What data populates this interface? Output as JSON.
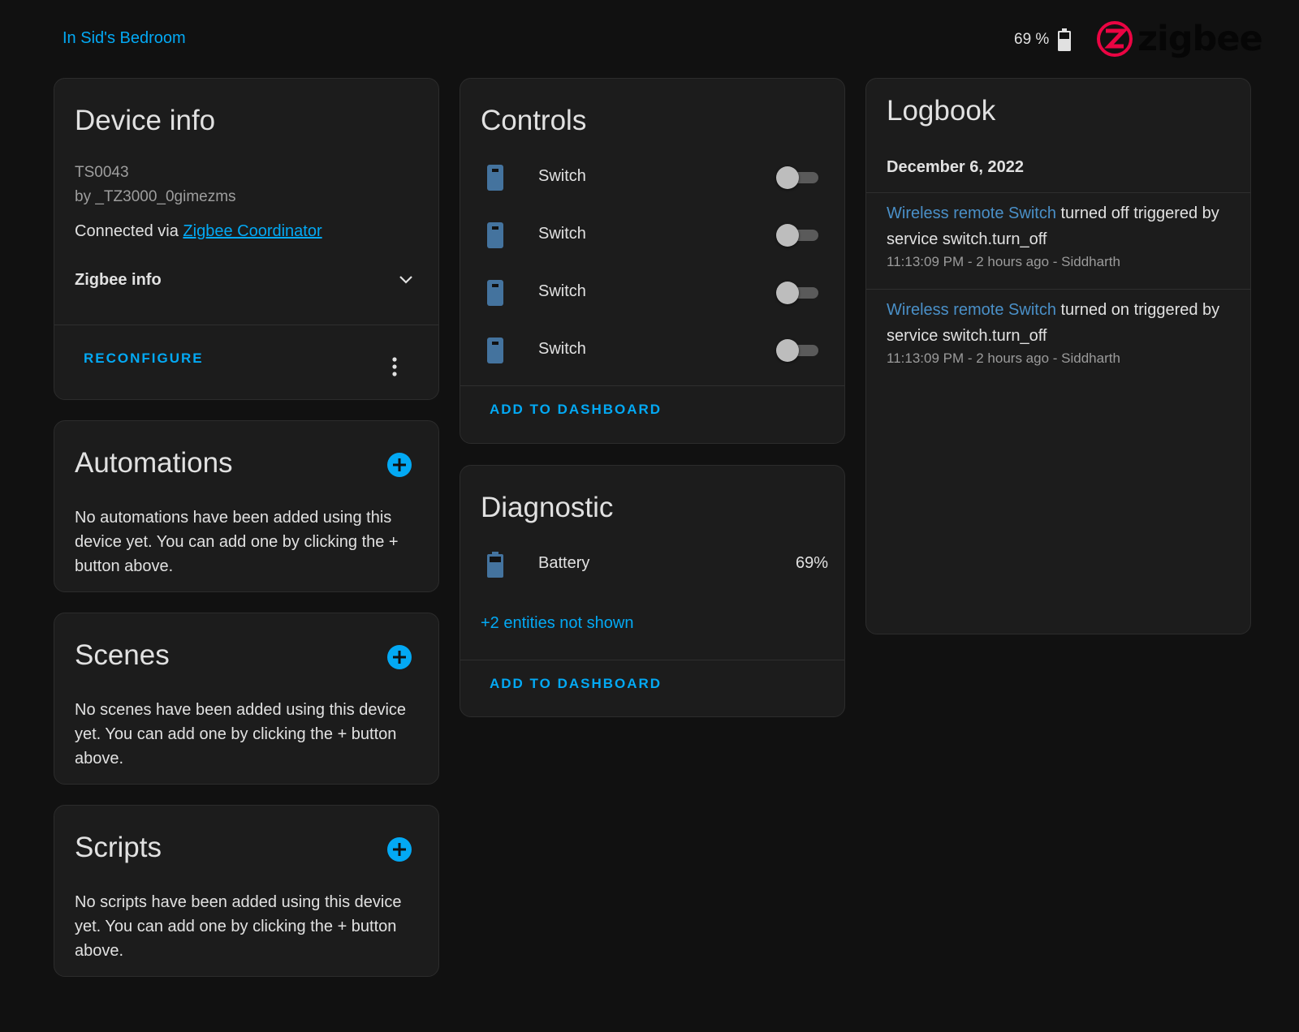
{
  "header": {
    "area_link": "In Sid's Bedroom",
    "battery": "69 %",
    "brand": "zigbee"
  },
  "device_info": {
    "title": "Device info",
    "model": "TS0043",
    "manufacturer": "by _TZ3000_0gimezms",
    "connected_prefix": "Connected via ",
    "connected_link": "Zigbee Coordinator",
    "zigbee_info": "Zigbee info",
    "reconfigure": "RECONFIGURE"
  },
  "automations": {
    "title": "Automations",
    "empty": "No automations have been added using this device yet. You can add one by clicking the + button above."
  },
  "scenes": {
    "title": "Scenes",
    "empty": "No scenes have been added using this device yet. You can add one by clicking the + button above."
  },
  "scripts": {
    "title": "Scripts",
    "empty": "No scripts have been added using this device yet. You can add one by clicking the + button above."
  },
  "controls": {
    "title": "Controls",
    "items": [
      {
        "label": "Switch",
        "state": "off"
      },
      {
        "label": "Switch",
        "state": "off"
      },
      {
        "label": "Switch",
        "state": "off"
      },
      {
        "label": "Switch",
        "state": "off"
      }
    ],
    "add_to_dashboard": "ADD TO DASHBOARD"
  },
  "diagnostic": {
    "title": "Diagnostic",
    "items": [
      {
        "label": "Battery",
        "value": "69%"
      }
    ],
    "more": "+2 entities not shown",
    "add_to_dashboard": "ADD TO DASHBOARD"
  },
  "logbook": {
    "title": "Logbook",
    "date": "December 6, 2022",
    "entries": [
      {
        "entity": "Wireless remote Switch",
        "action": " turned off triggered by service switch.turn_off",
        "meta": "11:13:09 PM - 2 hours ago - Siddharth"
      },
      {
        "entity": "Wireless remote Switch",
        "action": " turned on triggered by service switch.turn_off",
        "meta": "11:13:09 PM - 2 hours ago - Siddharth"
      }
    ]
  },
  "colors": {
    "accent": "#03a9f4",
    "entity_icon": "#44739e",
    "background": "#111111",
    "card": "#1c1c1c",
    "brand_red": "#eb0443"
  },
  "icons": {
    "battery_top": "battery-icon",
    "brand_logo": "zigbee-logo-icon",
    "switch": "remote-switch-icon",
    "battery_entity": "battery-entity-icon",
    "expand": "chevron-down-icon",
    "overflow": "dots-vertical-icon",
    "add": "plus-circle-icon"
  }
}
